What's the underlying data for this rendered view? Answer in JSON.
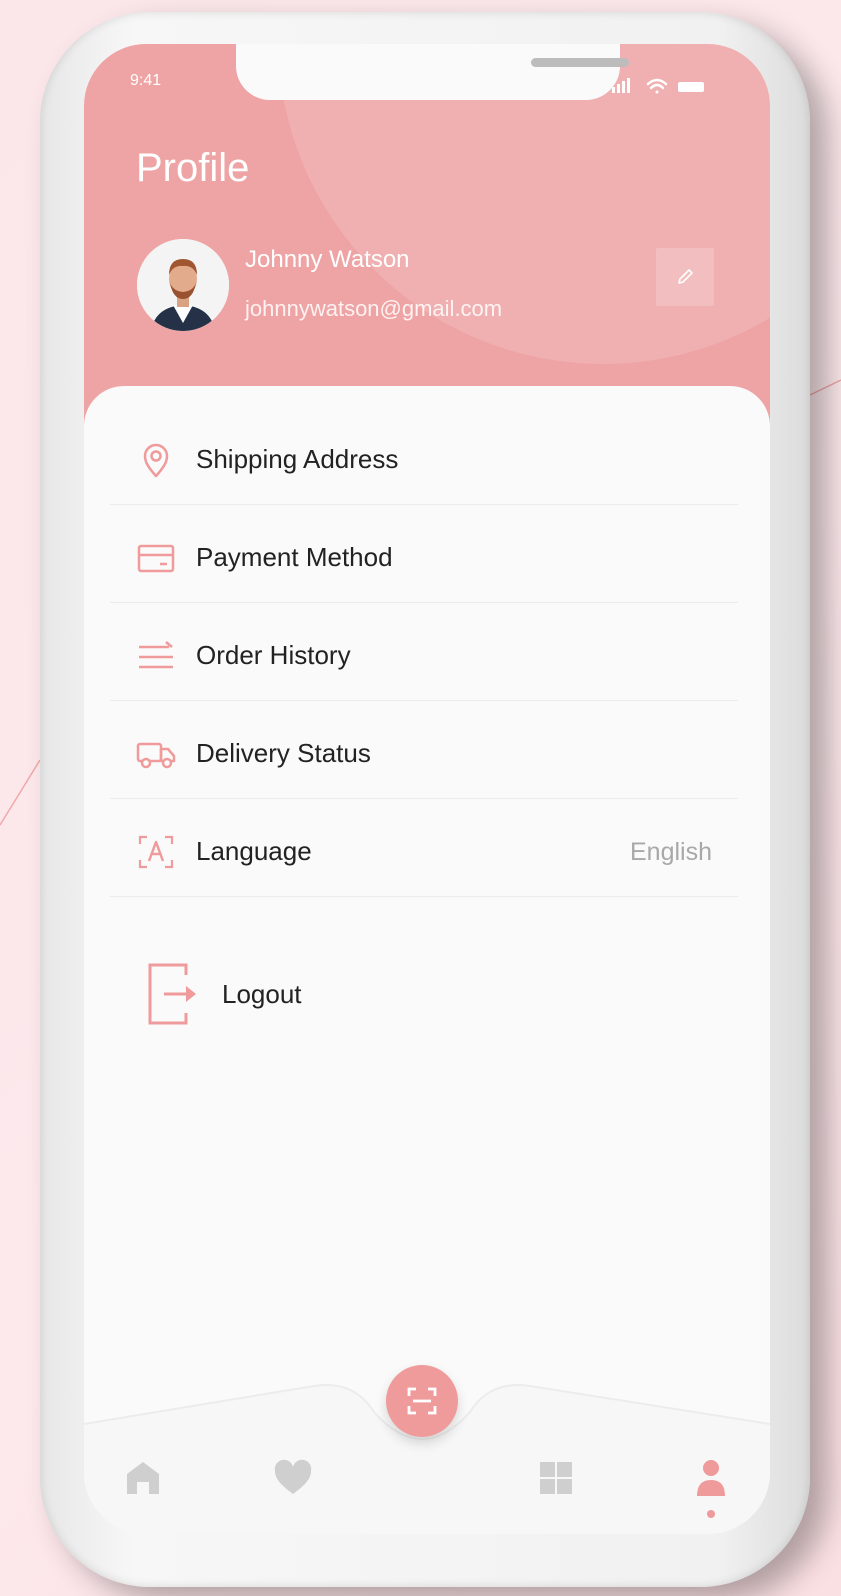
{
  "status_bar": {
    "time": "9:41"
  },
  "header": {
    "title": "Profile"
  },
  "user": {
    "name": "Johnny Watson",
    "email": "johnnywatson@gmail.com"
  },
  "menu": {
    "items": [
      {
        "label": "Shipping Address",
        "icon": "location-pin-icon"
      },
      {
        "label": "Payment Method",
        "icon": "credit-card-icon"
      },
      {
        "label": "Order History",
        "icon": "list-icon"
      },
      {
        "label": "Delivery Status",
        "icon": "truck-icon"
      },
      {
        "label": "Language",
        "icon": "language-icon",
        "value": "English"
      }
    ],
    "logout_label": "Logout"
  },
  "tabs": [
    {
      "icon": "home-icon",
      "active": false
    },
    {
      "icon": "heart-icon",
      "active": false
    },
    {
      "icon": "scan-icon",
      "active": false
    },
    {
      "icon": "grid-icon",
      "active": false
    },
    {
      "icon": "user-icon",
      "active": true
    }
  ],
  "colors": {
    "accent": "#ef9a9b",
    "header_bg": "#eea3a4",
    "inactive_icon": "#cfcfcf"
  }
}
